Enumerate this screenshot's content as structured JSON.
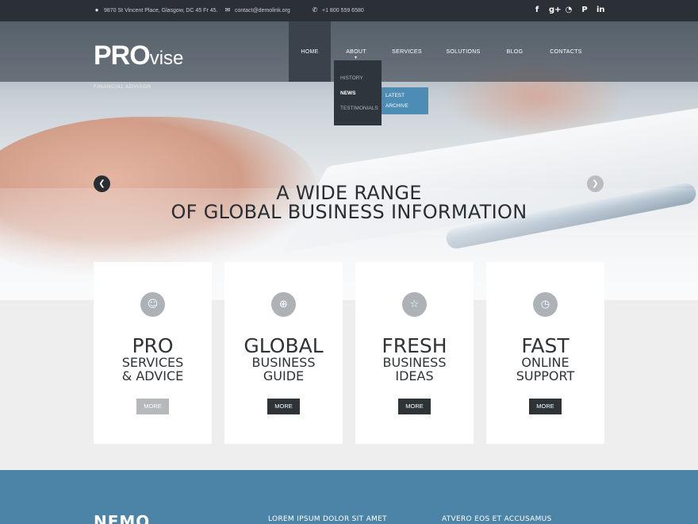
{
  "topbar": {
    "address": "9870 St Vincent Place, Glasgow, DC 45 Fr 45.",
    "email": "contact@demolink.org",
    "phone": "+1 800 559 6580",
    "social": [
      {
        "icon": "facebook-icon",
        "glyph": "f"
      },
      {
        "icon": "google-plus-icon",
        "glyph": "g+"
      },
      {
        "icon": "rss-icon",
        "glyph": "◔"
      },
      {
        "icon": "pinterest-icon",
        "glyph": "P"
      },
      {
        "icon": "linkedin-icon",
        "glyph": "in"
      }
    ]
  },
  "logo": {
    "pro": "PRO",
    "vise": "vise",
    "tagline": "FINANCIAL ADVISOR"
  },
  "nav": {
    "items": [
      "HOME",
      "ABOUT",
      "SERVICES",
      "SOLUTIONS",
      "BLOG",
      "CONTACTS"
    ],
    "active": "HOME",
    "open": "ABOUT"
  },
  "dropdown": {
    "items": [
      "HISTORY",
      "NEWS",
      "TESTIMONIALS"
    ],
    "selected": "NEWS"
  },
  "subdropdown": {
    "items": [
      "LATEST",
      "ARCHIVE"
    ]
  },
  "slider": {
    "line1": "A WIDE RANGE",
    "line2": "OF GLOBAL BUSINESS INFORMATION"
  },
  "cards": [
    {
      "icon": "user-icon",
      "glyph": "☺",
      "title": "PRO",
      "sub1": "SERVICES",
      "sub2": "& ADVICE",
      "more": "MORE"
    },
    {
      "icon": "globe-icon",
      "glyph": "⊕",
      "title": "GLOBAL",
      "sub1": "BUSINESS",
      "sub2": "GUIDE",
      "more": "MORE"
    },
    {
      "icon": "star-icon",
      "glyph": "☆",
      "title": "FRESH",
      "sub1": "BUSINESS",
      "sub2": "IDEAS",
      "more": "MORE"
    },
    {
      "icon": "clock-icon",
      "glyph": "◷",
      "title": "FAST",
      "sub1": "ONLINE",
      "sub2": "SUPPORT",
      "more": "MORE"
    }
  ],
  "band": {
    "heading": "NEMO",
    "col2": "LOREM IPSUM DOLOR SIT AMET",
    "col3": "ATVERO EOS ET ACCUSAMUS"
  },
  "colors": {
    "dark": "#2b2f36",
    "accent": "#4b84a7",
    "card": "#ffffff"
  }
}
